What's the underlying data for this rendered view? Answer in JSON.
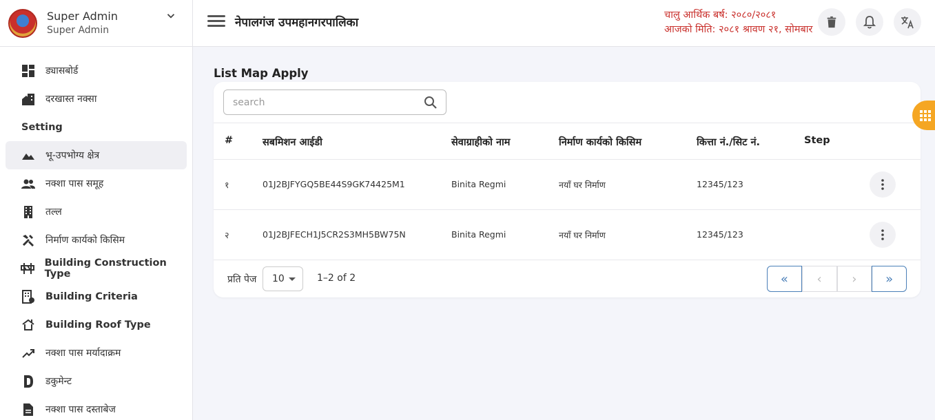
{
  "profile": {
    "name": "Super Admin",
    "role": "Super Admin"
  },
  "sidebar": {
    "items_top": [
      {
        "label": "ड्यासबोर्ड",
        "icon": "dashboard-icon"
      },
      {
        "label": "दरखास्त नक्सा",
        "icon": "home-work-icon"
      }
    ],
    "section_label": "Setting",
    "items_setting": [
      {
        "label": "भू-उपभोग्य क्षेत्र",
        "icon": "landscape-icon"
      },
      {
        "label": "नक्शा पास समूह",
        "icon": "people-icon"
      },
      {
        "label": "तल्ल",
        "icon": "building-icon"
      },
      {
        "label": "निर्माण कार्यको किसिम",
        "icon": "construction-icon"
      },
      {
        "label": "Building Construction Type",
        "icon": "roadblock-icon"
      },
      {
        "label": "Building Criteria",
        "icon": "domain-icon"
      },
      {
        "label": "Building Roof Type",
        "icon": "roofing-icon"
      },
      {
        "label": "नक्शा पास मर्यादाक्रम",
        "icon": "trending-up-icon"
      },
      {
        "label": "डकुमेन्ट",
        "icon": "document-icon"
      },
      {
        "label": "नक्शा पास दस्ताबेज",
        "icon": "description-icon"
      }
    ]
  },
  "header": {
    "title": "नेपालगंज उपमहानगरपालिका",
    "fiscal_year": "चालु आर्थिक बर्ष: २०८०/२०८१",
    "today": "आजको मिति: २०८१ श्रावण २१, सोमबार"
  },
  "main": {
    "heading": "List Map Apply",
    "search_placeholder": "search",
    "columns": [
      "#",
      "सबमिशन आईडी",
      "सेवाग्राहीको नाम",
      "निर्माण कार्यको किसिम",
      "कित्ता नं./सिट नं.",
      "Step"
    ],
    "rows": [
      {
        "num": "१",
        "submission_id": "01J2BJFYGQ5BE44S9GK74425M1",
        "name": "Binita Regmi",
        "work_type": "नयाँ घर निर्माण",
        "kitta": "12345/123",
        "step": ""
      },
      {
        "num": "२",
        "submission_id": "01J2BJFECH1J5CR2S3MH5BW75N",
        "name": "Binita Regmi",
        "work_type": "नयाँ घर निर्माण",
        "kitta": "12345/123",
        "step": ""
      }
    ],
    "per_page_label": "प्रति पेज",
    "per_page_value": "10",
    "range_text": "1–2 of 2"
  },
  "colors": {
    "accent_red": "#c9302c",
    "fab_orange": "#f5a623",
    "pager_blue": "#4a7fb8"
  }
}
